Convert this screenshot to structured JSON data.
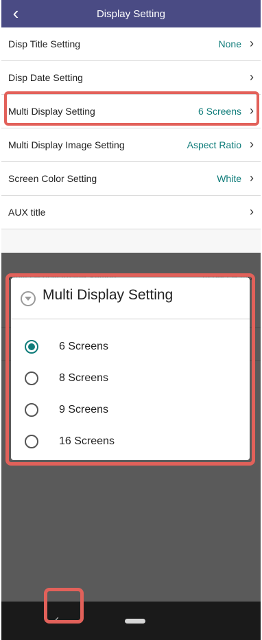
{
  "top": {
    "header": {
      "title": "Display Setting"
    },
    "rows": [
      {
        "label": "Disp Title Setting",
        "value": "None"
      },
      {
        "label": "Disp Date Setting",
        "value": ""
      },
      {
        "label": "Multi Display Setting",
        "value": "6 Screens"
      },
      {
        "label": "Multi Display Image Setting",
        "value": "Aspect Ratio"
      },
      {
        "label": "Screen Color Setting",
        "value": "White"
      },
      {
        "label": "AUX title",
        "value": ""
      }
    ]
  },
  "bottom": {
    "background_rows": [
      {
        "label": "Multi Display Image Setting",
        "value": "Aspect Ratio"
      }
    ],
    "dialog": {
      "title": "Multi Display Setting",
      "options": [
        {
          "label": "6 Screens",
          "selected": true
        },
        {
          "label": "8 Screens",
          "selected": false
        },
        {
          "label": "9 Screens",
          "selected": false
        },
        {
          "label": "16 Screens",
          "selected": false
        }
      ]
    }
  },
  "colors": {
    "appbar": "#4a4b84",
    "accent": "#0f7c7a",
    "highlight": "#e2615a",
    "overlay": "#5a5a5a"
  },
  "icons": {
    "back": "chevron-left-icon",
    "row_chevron": "chevron-right-icon",
    "dialog": "dropdown-circle-icon",
    "nav_back": "nav-back-icon",
    "nav_home": "nav-home-pill-icon"
  }
}
